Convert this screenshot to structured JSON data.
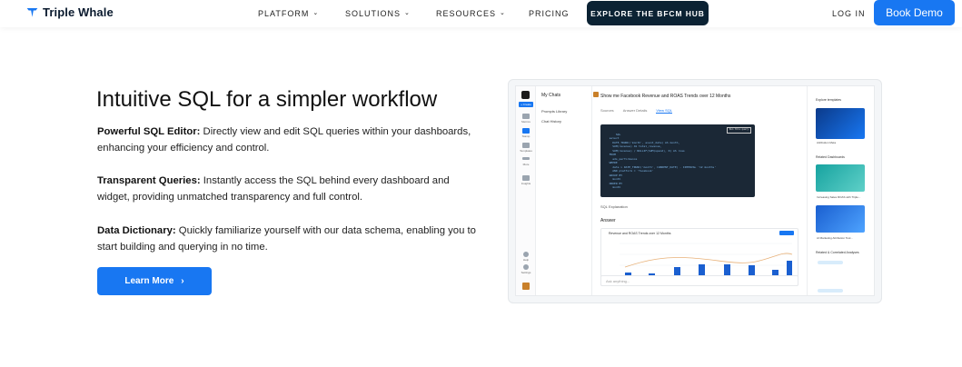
{
  "nav": {
    "brand": "Triple Whale",
    "links": [
      "PLATFORM",
      "SOLUTIONS",
      "RESOURCES",
      "PRICING"
    ],
    "cta": "EXPLORE THE BFCM HUB",
    "login": "LOG IN",
    "book": "Book Demo"
  },
  "hero": {
    "heading": "Intuitive SQL for a simpler workflow",
    "features": [
      {
        "title": "Powerful SQL Editor:",
        "text": " Directly view and edit SQL queries within your dashboards, enhancing your efficiency and control."
      },
      {
        "title": "Transparent Queries:",
        "text": " Instantly access the SQL behind every dashboard and widget, providing unmatched transparency and full control."
      },
      {
        "title": "Data Dictionary:",
        "text": " Quickly familiarize yourself with our data schema, enabling you to start building and querying in no time."
      }
    ],
    "button": "Learn More"
  },
  "mock": {
    "new_button": "+ Create",
    "side_labels": [
      "Metrics",
      "Stamp",
      "Templates",
      "More",
      "Insights",
      "Help",
      "Settings"
    ],
    "list_title": "My Chats",
    "list_items": [
      "Prompts Library",
      "Chat History"
    ],
    "query_title": "Show me Facebook Revenue and ROAS Trends over 12 Months",
    "tabs": [
      "Sources",
      "Answer Details",
      "View SQL"
    ],
    "copy_label": "Run this query",
    "code": "SQL\n  select\n    DATE_TRUNC('month', event_date) AS month,\n    SUM(revenue) AS total_revenue,\n    SUM(revenue) / NULLIF(SUM(spend), 0) AS roas\n  FROM\n    ads_performance\n  WHERE\n    date > DATE_TRUNC('month', CURRENT_DATE) - INTERVAL '12 months'\n    AND platform = 'facebook'\n  GROUP BY\n    month\n  ORDER BY\n    month",
    "sql_explanation": "SQL Explanation",
    "answer_label": "Answer",
    "chart_title": "Revenue and ROAS Trends over 12 Months",
    "ask_placeholder": "Ask anything...",
    "right_sections": [
      "Explore templates",
      "Related Dashboards",
      "Related & Correlated Analyses"
    ],
    "right_cards": [
      "Attribution Meta",
      "Increasing Sales ROAS with Triple...",
      "AI Marketing Attribution Tool..."
    ]
  },
  "colors": {
    "primary": "#1877f2",
    "navy": "#0b2233",
    "code_bg": "#1b2836"
  }
}
